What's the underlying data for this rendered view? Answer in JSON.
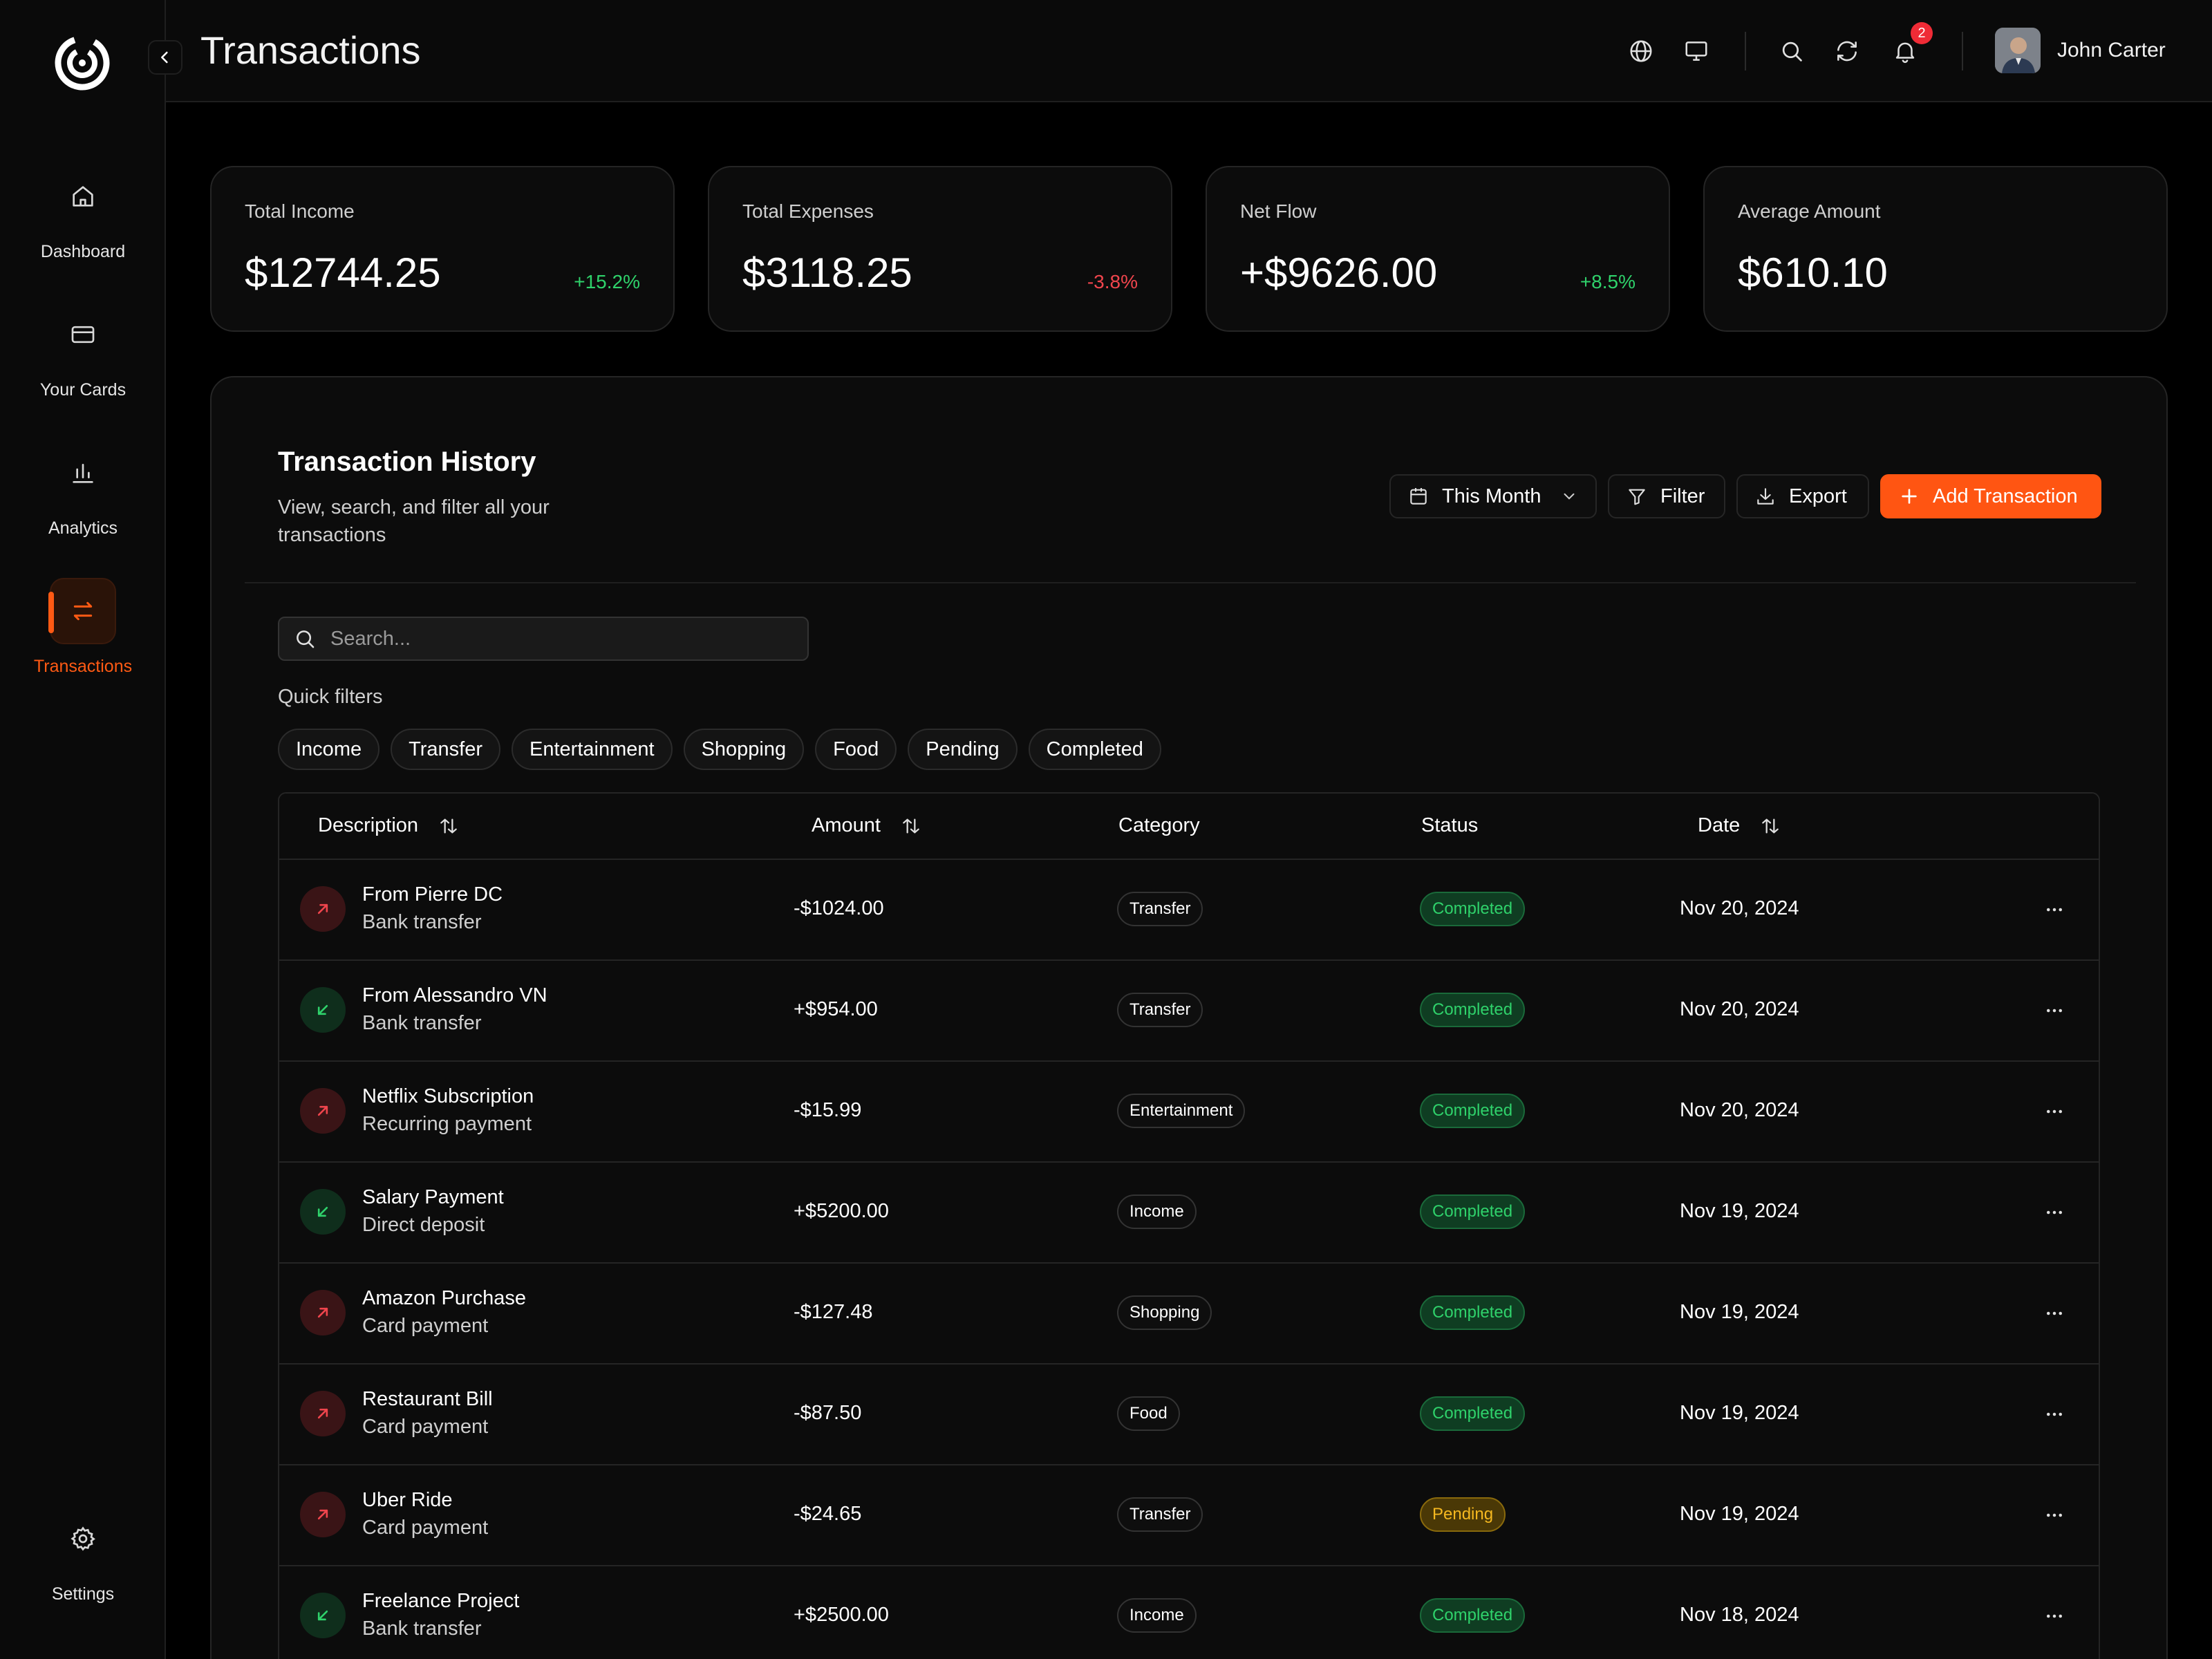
{
  "sidebar": {
    "items": [
      {
        "label": "Dashboard",
        "icon": "home-icon"
      },
      {
        "label": "Your Cards",
        "icon": "card-icon"
      },
      {
        "label": "Analytics",
        "icon": "bar-chart-icon"
      },
      {
        "label": "Transactions",
        "icon": "swap-arrows-icon",
        "active": true
      }
    ],
    "settings_label": "Settings"
  },
  "header": {
    "title": "Transactions",
    "notification_count": "2",
    "user_name": "John Carter"
  },
  "stats": [
    {
      "label": "Total Income",
      "value": "$12744.25",
      "delta": "+15.2%",
      "trend": "up"
    },
    {
      "label": "Total Expenses",
      "value": "$3118.25",
      "delta": "-3.8%",
      "trend": "down"
    },
    {
      "label": "Net Flow",
      "value": "+$9626.00",
      "delta": "+8.5%",
      "trend": "up"
    },
    {
      "label": "Average Amount",
      "value": "$610.10",
      "delta": "",
      "trend": ""
    }
  ],
  "history": {
    "title": "Transaction History",
    "subtitle": "View, search, and filter all your transactions",
    "period_label": "This Month",
    "filter_label": "Filter",
    "export_label": "Export",
    "add_label": "Add Transaction",
    "search_placeholder": "Search...",
    "quick_filters_label": "Quick filters",
    "quick_filters": [
      "Income",
      "Transfer",
      "Entertainment",
      "Shopping",
      "Food",
      "Pending",
      "Completed"
    ],
    "columns": {
      "description": "Description",
      "amount": "Amount",
      "category": "Category",
      "status": "Status",
      "date": "Date"
    },
    "rows": [
      {
        "title": "From Pierre DC",
        "sub": "Bank transfer",
        "amount": "-$1024.00",
        "category": "Transfer",
        "status": "Completed",
        "date": "Nov 20, 2024",
        "direction": "out"
      },
      {
        "title": "From Alessandro VN",
        "sub": "Bank transfer",
        "amount": "+$954.00",
        "category": "Transfer",
        "status": "Completed",
        "date": "Nov 20, 2024",
        "direction": "in"
      },
      {
        "title": "Netflix Subscription",
        "sub": "Recurring payment",
        "amount": "-$15.99",
        "category": "Entertainment",
        "status": "Completed",
        "date": "Nov 20, 2024",
        "direction": "out"
      },
      {
        "title": "Salary Payment",
        "sub": "Direct deposit",
        "amount": "+$5200.00",
        "category": "Income",
        "status": "Completed",
        "date": "Nov 19, 2024",
        "direction": "in"
      },
      {
        "title": "Amazon Purchase",
        "sub": "Card payment",
        "amount": "-$127.48",
        "category": "Shopping",
        "status": "Completed",
        "date": "Nov 19, 2024",
        "direction": "out"
      },
      {
        "title": "Restaurant Bill",
        "sub": "Card payment",
        "amount": "-$87.50",
        "category": "Food",
        "status": "Completed",
        "date": "Nov 19, 2024",
        "direction": "out"
      },
      {
        "title": "Uber Ride",
        "sub": "Card payment",
        "amount": "-$24.65",
        "category": "Transfer",
        "status": "Pending",
        "date": "Nov 19, 2024",
        "direction": "out"
      },
      {
        "title": "Freelance Project",
        "sub": "Bank transfer",
        "amount": "+$2500.00",
        "category": "Income",
        "status": "Completed",
        "date": "Nov 18, 2024",
        "direction": "in"
      }
    ]
  },
  "colors": {
    "accent": "#ff5512",
    "positive": "#2fd26b",
    "negative": "#f0454d",
    "pending": "#f5b820"
  }
}
